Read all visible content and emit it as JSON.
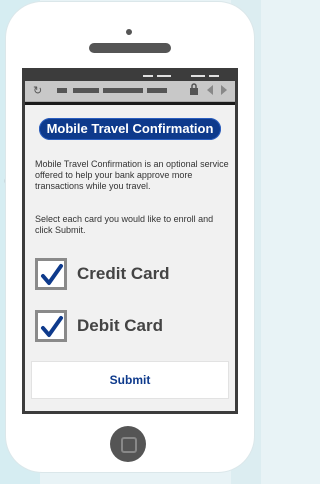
{
  "icons": {
    "refresh": "refresh-icon",
    "lock": "lock-icon",
    "back": "back-arrow-icon",
    "forward": "forward-arrow-icon",
    "checkmark": "checkmark-icon",
    "home": "home-button-icon"
  },
  "header": {
    "title": "Mobile Travel Confirmation"
  },
  "content": {
    "description": "Mobile Travel Confirmation is an optional service offered to help your bank approve more transactions while you travel.",
    "instruction": "Select each card you would like to enroll and click Submit."
  },
  "options": [
    {
      "label": "Credit Card",
      "checked": true
    },
    {
      "label": "Debit Card",
      "checked": true
    }
  ],
  "actions": {
    "submit_label": "Submit"
  },
  "colors": {
    "header_bg": "#0e3a8c",
    "check": "#0e3a8c",
    "screen_bg": "#f1f1f1"
  }
}
